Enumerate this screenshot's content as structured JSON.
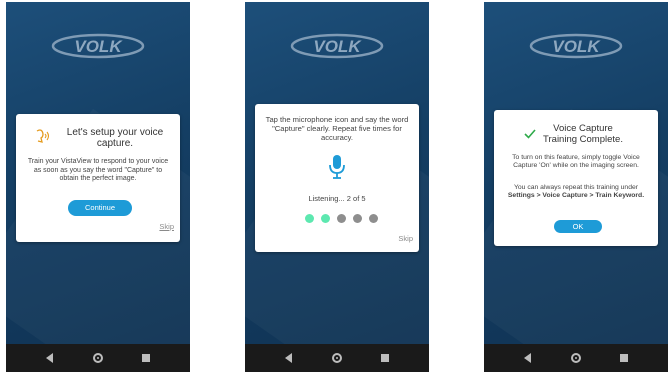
{
  "brand": {
    "logo_text": "VOLK"
  },
  "screens": [
    {
      "title": "Let's setup your voice capture.",
      "body": "Train your VistaView to respond to your voice as soon as you say the word \"Capture\" to obtain the perfect image.",
      "button_label": "Continue",
      "skip_label": "Skip",
      "icon": "voice-speaking-icon",
      "accent_color": "#e59b1e"
    },
    {
      "instruction": "Tap the microphone icon and say the word \"Capture\" clearly. Repeat five times for accuracy.",
      "status": "Listening... 2 of 5",
      "progress": {
        "completed": 2,
        "total": 5
      },
      "skip_label": "Skip",
      "icon": "microphone-icon",
      "mic_color": "#1e9bd7",
      "dot_active_color": "#5de8b0",
      "dot_inactive_color": "#8e8e8e"
    },
    {
      "title": "Voice Capture Training Complete.",
      "body1": "To turn on this feature, simply toggle Voice Capture 'On' while on the imaging screen.",
      "body2_prefix": "You can always repeat this training under ",
      "body2_bold": "Settings > Voice Capture > Train Keyword.",
      "button_label": "OK",
      "icon": "checkmark-icon",
      "check_color": "#2eaa4a"
    }
  ],
  "navigation": {
    "back_icon": "back-icon",
    "home_icon": "home-icon",
    "recent_icon": "recent-apps-icon"
  },
  "colors": {
    "background": "#143e63",
    "accent": "#1e9bd7",
    "navbar": "#1a1a1a"
  }
}
